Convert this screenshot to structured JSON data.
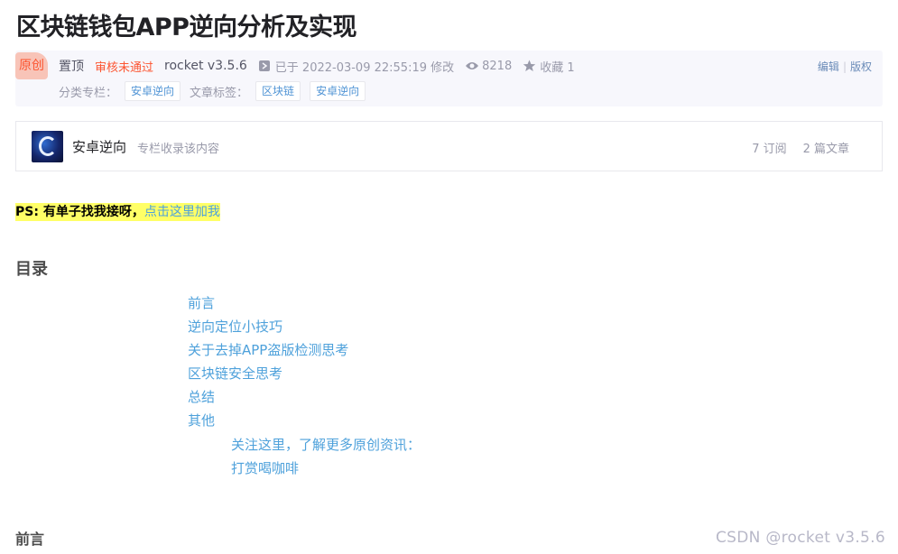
{
  "article": {
    "title": "区块链钱包APP逆向分析及实现"
  },
  "meta": {
    "badge": "原创",
    "pinned": "置顶",
    "audit_status": "审核未通过",
    "author": "rocket v3.5.6",
    "modified": "已于 2022-03-09 22:55:19 修改",
    "views": "8218",
    "favorites": "收藏 1",
    "edit_label": "编辑",
    "copyright_label": "版权",
    "category_label": "分类专栏：",
    "categories": [
      "安卓逆向"
    ],
    "tags_label": "文章标签：",
    "tags": [
      "区块链",
      "安卓逆向"
    ],
    "colors": {
      "accent": "#fc5531",
      "link": "#4ea1db"
    }
  },
  "column": {
    "name": "安卓逆向",
    "desc": "专栏收录该内容",
    "subscriptions": "7 订阅",
    "articles": "2 篇文章"
  },
  "ps": {
    "text": "PS: 有单子找我接呀，",
    "link": "点击这里加我",
    "highlight": "#ffff66"
  },
  "toc": {
    "heading": "目录",
    "items": [
      "前言",
      "逆向定位小技巧",
      "关于去掉APP盗版检测思考",
      "区块链安全思考",
      "总结",
      "其他"
    ],
    "sub_items": [
      "关注这里，了解更多原创资讯：",
      "打赏喝咖啡"
    ]
  },
  "section": {
    "heading": "前言"
  },
  "watermark": "CSDN @rocket v3.5.6"
}
